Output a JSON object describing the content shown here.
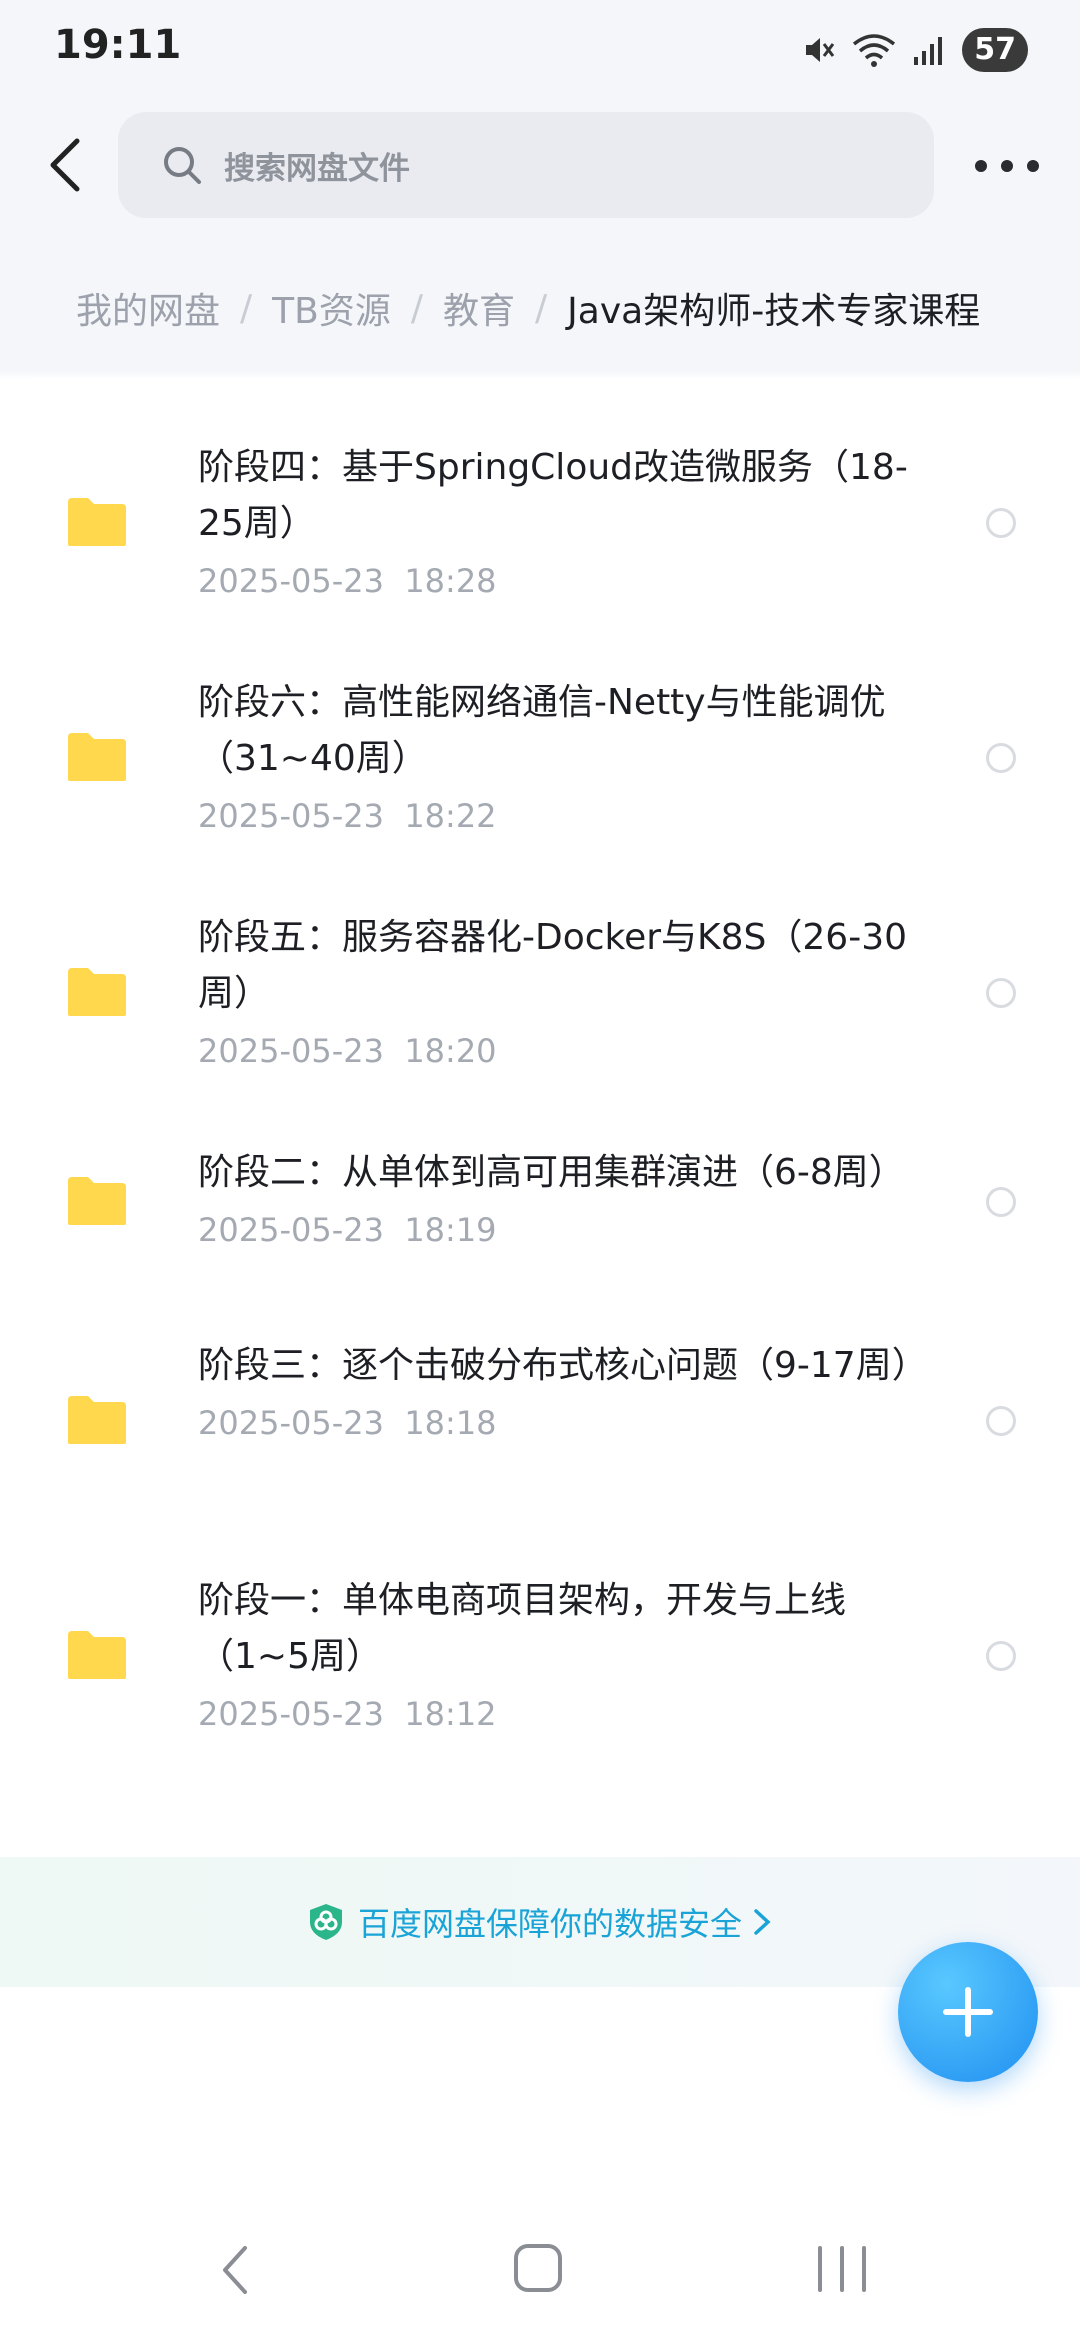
{
  "status_bar": {
    "time": "19:11",
    "battery": "57",
    "icons": [
      "mute-icon",
      "wifi-icon",
      "signal-icon",
      "battery-icon"
    ]
  },
  "header": {
    "search_placeholder": "搜索网盘文件"
  },
  "breadcrumb": {
    "items": [
      "我的网盘",
      "TB资源",
      "教育"
    ],
    "separator": "/",
    "current": "Java架构师-技术专家课程"
  },
  "files": [
    {
      "name": "阶段四：基于SpringCloud改造微服务（18-25周）",
      "time": "2025-05-23  18:28"
    },
    {
      "name": "阶段六：高性能网络通信-Netty与性能调优（31~40周）",
      "time": "2025-05-23  18:22"
    },
    {
      "name": "阶段五：服务容器化-Docker与K8S（26-30周）",
      "time": "2025-05-23  18:20"
    },
    {
      "name": "阶段二：从单体到高可用集群演进（6-8周）",
      "time": "2025-05-23  18:19"
    },
    {
      "name": "阶段三：逐个击破分布式核心问题（9-17周）",
      "time": "2025-05-23  18:18"
    },
    {
      "name": "阶段一：单体电商项目架构，开发与上线（1~5周）",
      "time": "2025-05-23  18:12"
    }
  ],
  "security_banner": {
    "text": "百度网盘保障你的数据安全"
  },
  "colors": {
    "folder": "#ffd84d",
    "accent": "#1aa3d6",
    "fab": "#2b9cf5"
  }
}
